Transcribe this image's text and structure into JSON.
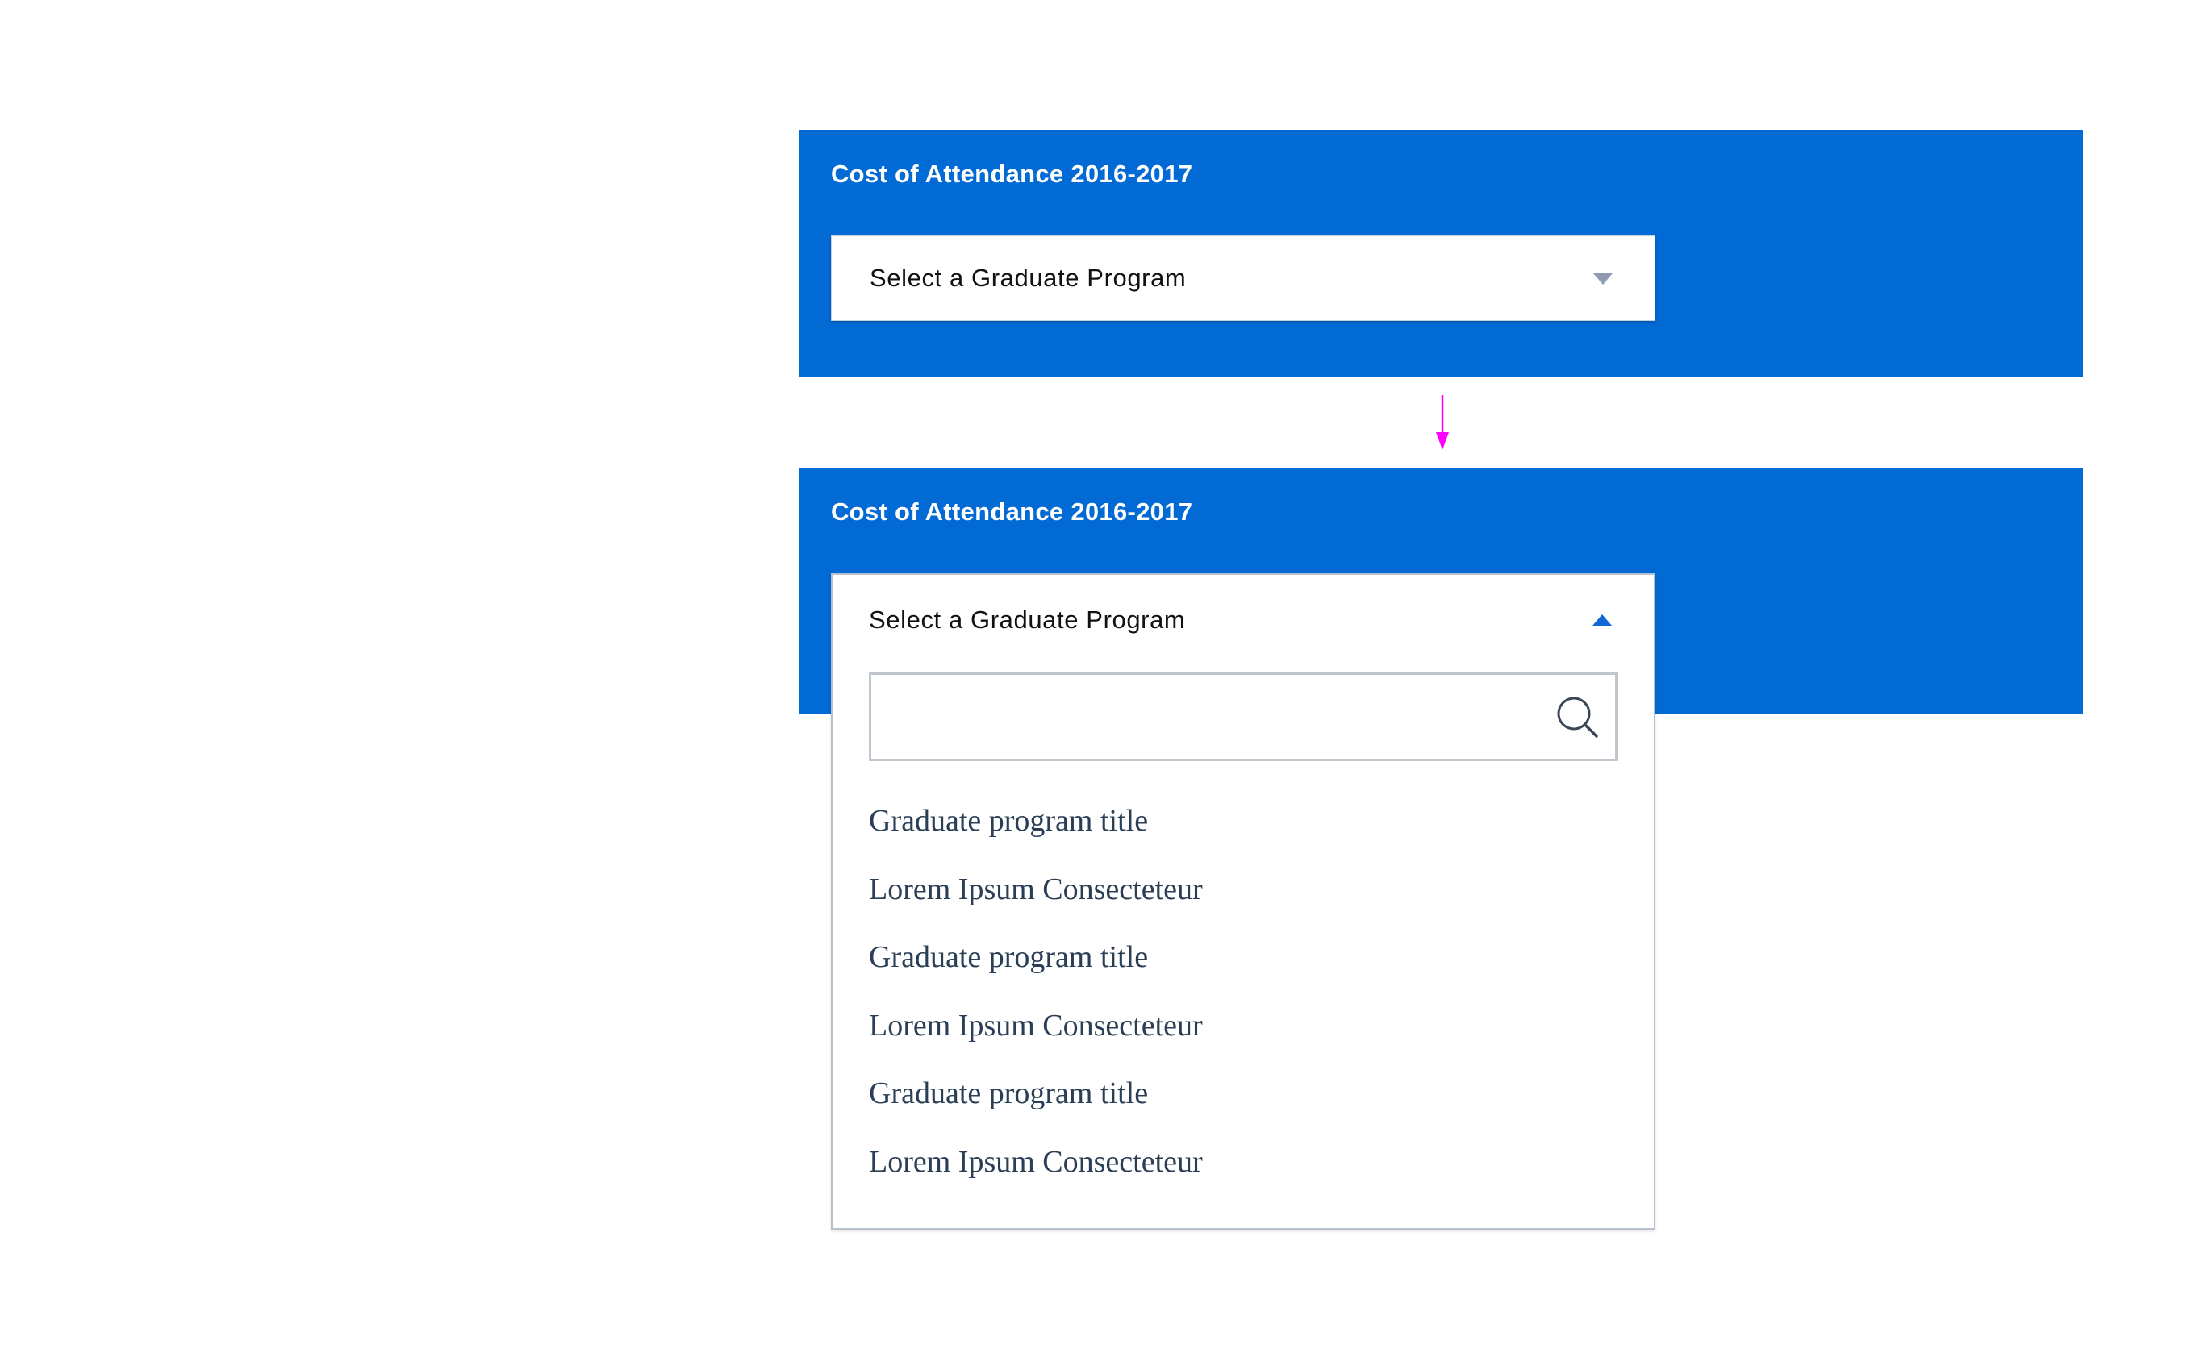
{
  "states": {
    "collapsed": {
      "title": "Cost of Attendance 2016-2017",
      "select_label": "Select a Graduate Program"
    },
    "expanded": {
      "title": "Cost of Attendance 2016-2017",
      "select_label": "Select a Graduate Program",
      "search": {
        "value": "",
        "placeholder": ""
      },
      "options": [
        "Graduate program title",
        "Lorem Ipsum Consecteteur",
        "Graduate program title",
        "Lorem Ipsum Consecteteur",
        "Graduate program title",
        "Lorem Ipsum Consecteteur"
      ]
    }
  },
  "icons": {
    "collapsed_caret": "chevron-down-icon",
    "expanded_caret": "chevron-up-icon",
    "search": "search-icon",
    "transition": "arrow-down-icon"
  },
  "colors": {
    "panel_background": "#016ad5",
    "panel_title": "#ffffff",
    "collapsed_caret": "#8f9bb1",
    "expanded_caret": "#1166d8",
    "option_text": "#2a3f56",
    "transition_arrow": "#ff00ff"
  }
}
